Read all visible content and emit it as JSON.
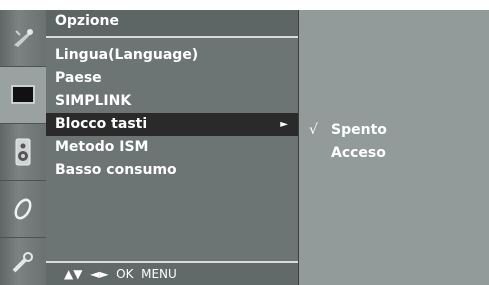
{
  "sidebar": {
    "icons": [
      {
        "name": "picture-icon"
      },
      {
        "name": "screen-icon"
      },
      {
        "name": "audio-icon"
      },
      {
        "name": "time-icon"
      },
      {
        "name": "option-icon"
      }
    ]
  },
  "menu": {
    "title": "Opzione",
    "items": [
      {
        "label": "Lingua(Language)"
      },
      {
        "label": "Paese"
      },
      {
        "label": "SIMPLINK"
      },
      {
        "label": "Blocco tasti",
        "arrow": "►"
      },
      {
        "label": "Metodo ISM"
      },
      {
        "label": "Basso consumo"
      }
    ],
    "selected_index": 3
  },
  "submenu": {
    "items": [
      {
        "label": "Spento",
        "check": "√"
      },
      {
        "label": "Acceso",
        "check": ""
      }
    ]
  },
  "navbar": {
    "text": "▲▼  ◄►  OK  MENU"
  },
  "colors": {
    "background": "#8e9696",
    "panel": "#6d7474",
    "selected_row": "#2a2a2a",
    "text": "#ffffff"
  }
}
